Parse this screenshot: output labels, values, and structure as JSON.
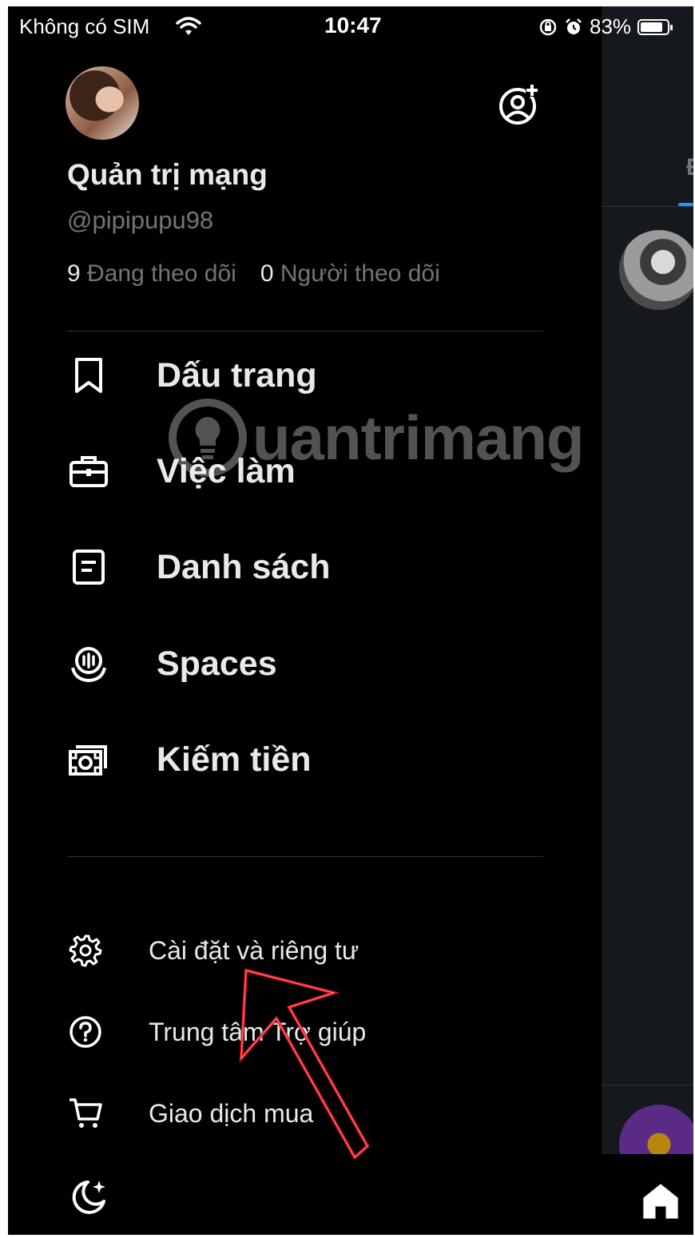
{
  "status_bar": {
    "carrier": "Không có SIM",
    "time": "10:47",
    "battery": "83%",
    "battery_level": 0.83
  },
  "profile": {
    "display_name": "Quản trị mạng",
    "handle": "@pipipupu98",
    "following_count": "9",
    "following_label": "Đang theo dõi",
    "followers_count": "0",
    "followers_label": "Người theo dõi"
  },
  "menu": [
    {
      "label": "Dấu trang",
      "icon": "bookmark-icon"
    },
    {
      "label": "Việc làm",
      "icon": "briefcase-icon"
    },
    {
      "label": "Danh sách",
      "icon": "list-icon"
    },
    {
      "label": "Spaces",
      "icon": "spaces-icon"
    },
    {
      "label": "Kiếm tiền",
      "icon": "money-icon"
    }
  ],
  "secondary_menu": [
    {
      "label": "Cài đặt và riêng tư",
      "icon": "gear-icon"
    },
    {
      "label": "Trung tâm Trợ giúp",
      "icon": "help-icon"
    },
    {
      "label": "Giao dịch mua",
      "icon": "cart-icon"
    }
  ],
  "feed_peek": {
    "tab_letter": "Đ"
  },
  "watermark": {
    "text": "uantrimang"
  },
  "colors": {
    "background": "#000000",
    "primary_text": "#e7e9ea",
    "secondary_text": "#71767b",
    "divider": "#2f3336",
    "accent": "#1d9bf0",
    "annotation": "#e0141e"
  }
}
